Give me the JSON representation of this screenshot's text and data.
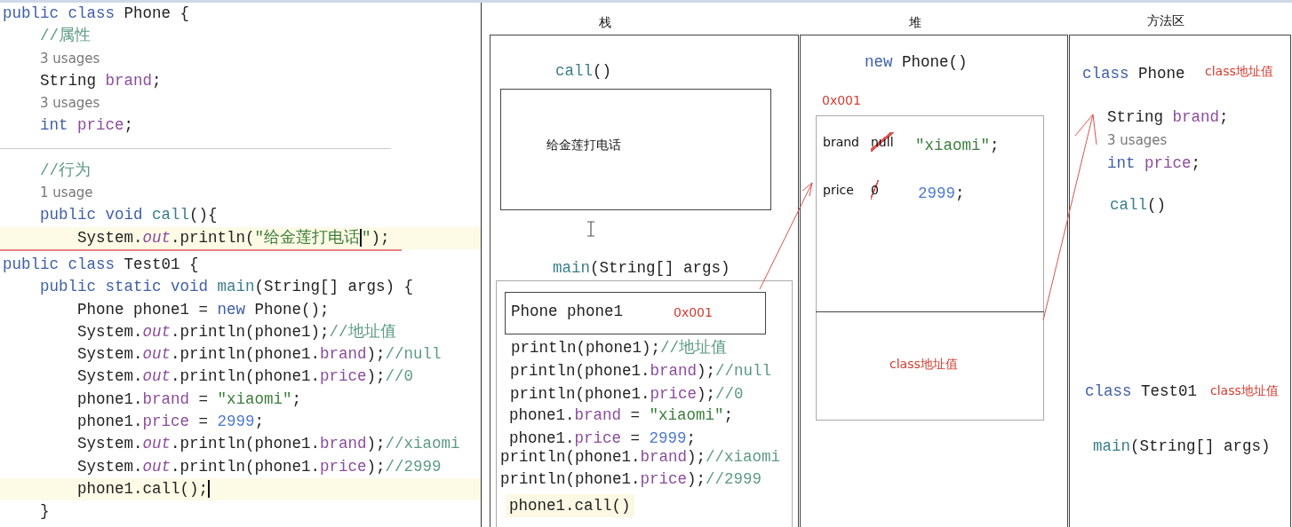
{
  "editor": {
    "lines": [
      {
        "kind": "code",
        "highlighted": false,
        "tokens": [
          {
            "text": "public class ",
            "kind": "kw"
          },
          {
            "text": "Phone {",
            "kind": "plain"
          }
        ]
      },
      {
        "kind": "code",
        "highlighted": false,
        "tokens": [
          {
            "text": "    //属性",
            "kind": "cmt"
          }
        ]
      },
      {
        "kind": "hint",
        "highlighted": false,
        "tokens": [
          {
            "text": "3 usages",
            "kind": "hint"
          }
        ]
      },
      {
        "kind": "code",
        "highlighted": false,
        "tokens": [
          {
            "text": "    String ",
            "kind": "plain"
          },
          {
            "text": "brand",
            "kind": "field"
          },
          {
            "text": ";",
            "kind": "plain"
          }
        ]
      },
      {
        "kind": "hint",
        "highlighted": false,
        "tokens": [
          {
            "text": "3 usages",
            "kind": "hint"
          }
        ]
      },
      {
        "kind": "code",
        "highlighted": false,
        "tokens": [
          {
            "text": "    int ",
            "kind": "kw"
          },
          {
            "text": "price",
            "kind": "field"
          },
          {
            "text": ";",
            "kind": "plain"
          }
        ]
      },
      {
        "kind": "divider"
      },
      {
        "kind": "code",
        "highlighted": false,
        "tokens": [
          {
            "text": "    //行为",
            "kind": "cmt"
          }
        ]
      },
      {
        "kind": "hint",
        "highlighted": false,
        "tokens": [
          {
            "text": "1 usage",
            "kind": "hint"
          }
        ]
      },
      {
        "kind": "code",
        "highlighted": false,
        "tokens": [
          {
            "text": "    public void ",
            "kind": "kw"
          },
          {
            "text": "call",
            "kind": "method"
          },
          {
            "text": "(){",
            "kind": "plain"
          }
        ]
      },
      {
        "kind": "code",
        "highlighted": true,
        "tokens": [
          {
            "text": "        System.",
            "kind": "plain"
          },
          {
            "text": "out",
            "kind": "static"
          },
          {
            "text": ".println(",
            "kind": "plain"
          },
          {
            "text": "\"给金莲打电话",
            "kind": "str",
            "caret": true
          },
          {
            "text": "\"",
            "kind": "str"
          },
          {
            "text": ");",
            "kind": "plain"
          }
        ]
      },
      {
        "kind": "rule"
      },
      {
        "kind": "code",
        "highlighted": false,
        "tokens": [
          {
            "text": "public class ",
            "kind": "kw"
          },
          {
            "text": "Test01 {",
            "kind": "plain"
          }
        ]
      },
      {
        "kind": "code",
        "highlighted": false,
        "tokens": [
          {
            "text": "    public static void ",
            "kind": "kw"
          },
          {
            "text": "main",
            "kind": "method"
          },
          {
            "text": "(String[] args) {",
            "kind": "plain"
          }
        ]
      },
      {
        "kind": "code",
        "highlighted": false,
        "tokens": [
          {
            "text": "        Phone phone1 = ",
            "kind": "plain"
          },
          {
            "text": "new",
            "kind": "kw"
          },
          {
            "text": " Phone();",
            "kind": "plain"
          }
        ]
      },
      {
        "kind": "code",
        "highlighted": false,
        "tokens": [
          {
            "text": "        System.",
            "kind": "plain"
          },
          {
            "text": "out",
            "kind": "static"
          },
          {
            "text": ".println(phone1);",
            "kind": "plain"
          },
          {
            "text": "//地址值",
            "kind": "cmt"
          }
        ]
      },
      {
        "kind": "code",
        "highlighted": false,
        "tokens": [
          {
            "text": "        System.",
            "kind": "plain"
          },
          {
            "text": "out",
            "kind": "static"
          },
          {
            "text": ".println(phone1.",
            "kind": "plain"
          },
          {
            "text": "brand",
            "kind": "field"
          },
          {
            "text": ");",
            "kind": "plain"
          },
          {
            "text": "//null",
            "kind": "cmt"
          }
        ]
      },
      {
        "kind": "code",
        "highlighted": false,
        "tokens": [
          {
            "text": "        System.",
            "kind": "plain"
          },
          {
            "text": "out",
            "kind": "static"
          },
          {
            "text": ".println(phone1.",
            "kind": "plain"
          },
          {
            "text": "price",
            "kind": "field"
          },
          {
            "text": ");",
            "kind": "plain"
          },
          {
            "text": "//0",
            "kind": "cmt"
          }
        ]
      },
      {
        "kind": "code",
        "highlighted": false,
        "tokens": [
          {
            "text": "        phone1.",
            "kind": "plain"
          },
          {
            "text": "brand",
            "kind": "field"
          },
          {
            "text": " = ",
            "kind": "plain"
          },
          {
            "text": "\"xiaomi\"",
            "kind": "str"
          },
          {
            "text": ";",
            "kind": "plain"
          }
        ]
      },
      {
        "kind": "code",
        "highlighted": false,
        "tokens": [
          {
            "text": "        phone1.",
            "kind": "plain"
          },
          {
            "text": "price",
            "kind": "field"
          },
          {
            "text": " = ",
            "kind": "plain"
          },
          {
            "text": "2999",
            "kind": "num"
          },
          {
            "text": ";",
            "kind": "plain"
          }
        ]
      },
      {
        "kind": "code",
        "highlighted": false,
        "tokens": [
          {
            "text": "        System.",
            "kind": "plain"
          },
          {
            "text": "out",
            "kind": "static"
          },
          {
            "text": ".println(phone1.",
            "kind": "plain"
          },
          {
            "text": "brand",
            "kind": "field"
          },
          {
            "text": ");",
            "kind": "plain"
          },
          {
            "text": "//xiaomi",
            "kind": "cmt"
          }
        ]
      },
      {
        "kind": "code",
        "highlighted": false,
        "tokens": [
          {
            "text": "        System.",
            "kind": "plain"
          },
          {
            "text": "out",
            "kind": "static"
          },
          {
            "text": ".println(phone1.",
            "kind": "plain"
          },
          {
            "text": "price",
            "kind": "field"
          },
          {
            "text": ");",
            "kind": "plain"
          },
          {
            "text": "//2999",
            "kind": "cmt"
          }
        ]
      },
      {
        "kind": "code",
        "highlighted": true,
        "tokens": [
          {
            "text": "        phone1.call();",
            "kind": "plain",
            "caret": true
          }
        ]
      },
      {
        "kind": "code",
        "highlighted": false,
        "tokens": [
          {
            "text": "    }",
            "kind": "plain"
          }
        ]
      }
    ]
  },
  "memory_diagram": {
    "stack": {
      "title": "栈",
      "call_frame": {
        "label": [
          {
            "text": "call",
            "kind": "method"
          },
          {
            "text": "()",
            "kind": "plain"
          }
        ],
        "output": "给金莲打电话"
      },
      "main_frame": {
        "label": [
          {
            "text": "main",
            "kind": "method"
          },
          {
            "text": "(String[] args)",
            "kind": "plain"
          }
        ],
        "variable": {
          "declaration": "Phone phone1",
          "value": "0x001"
        },
        "lines": [
          {
            "highlighted": false,
            "tokens": [
              {
                "text": "println(phone1);",
                "kind": "plain"
              },
              {
                "text": "//地址值",
                "kind": "cmt"
              }
            ]
          },
          {
            "highlighted": false,
            "tokens": [
              {
                "text": "println(phone1.",
                "kind": "plain"
              },
              {
                "text": "brand",
                "kind": "field"
              },
              {
                "text": ");",
                "kind": "plain"
              },
              {
                "text": "//null",
                "kind": "cmt"
              }
            ]
          },
          {
            "highlighted": false,
            "tokens": [
              {
                "text": "println(phone1.",
                "kind": "plain"
              },
              {
                "text": "price",
                "kind": "field"
              },
              {
                "text": ");",
                "kind": "plain"
              },
              {
                "text": "//0",
                "kind": "cmt"
              }
            ]
          },
          {
            "highlighted": false,
            "tokens": [
              {
                "text": "phone1.",
                "kind": "plain"
              },
              {
                "text": "brand",
                "kind": "field"
              },
              {
                "text": " = ",
                "kind": "plain"
              },
              {
                "text": "\"xiaomi\"",
                "kind": "str"
              },
              {
                "text": ";",
                "kind": "plain"
              }
            ]
          },
          {
            "highlighted": false,
            "tokens": [
              {
                "text": "phone1.",
                "kind": "plain"
              },
              {
                "text": "price",
                "kind": "field"
              },
              {
                "text": " = ",
                "kind": "plain"
              },
              {
                "text": "2999",
                "kind": "num"
              },
              {
                "text": ";",
                "kind": "plain"
              }
            ]
          },
          {
            "highlighted": false,
            "tokens": [
              {
                "text": "println(phone1.",
                "kind": "plain"
              },
              {
                "text": "brand",
                "kind": "field"
              },
              {
                "text": ");",
                "kind": "plain"
              },
              {
                "text": "//xiaomi",
                "kind": "cmt"
              }
            ]
          },
          {
            "highlighted": false,
            "tokens": [
              {
                "text": "println(phone1.",
                "kind": "plain"
              },
              {
                "text": "price",
                "kind": "field"
              },
              {
                "text": ");",
                "kind": "plain"
              },
              {
                "text": "//2999",
                "kind": "cmt"
              }
            ]
          },
          {
            "highlighted": true,
            "tokens": [
              {
                "text": "phone1.call()",
                "kind": "plain"
              }
            ]
          }
        ]
      }
    },
    "heap": {
      "title": "堆",
      "object": {
        "label": [
          {
            "text": "new",
            "kind": "kw"
          },
          {
            "text": " Phone()",
            "kind": "plain"
          }
        ],
        "address": "0x001",
        "fields": [
          {
            "name": "brand",
            "old_value": "null",
            "crossed_out": true,
            "new_value": [
              {
                "text": "\"xiaomi\"",
                "kind": "str"
              },
              {
                "text": ";",
                "kind": "plain"
              }
            ]
          },
          {
            "name": "price",
            "old_value": "0",
            "crossed_out": true,
            "new_value": [
              {
                "text": "2999",
                "kind": "num"
              },
              {
                "text": ";",
                "kind": "plain"
              }
            ]
          }
        ],
        "class_ref": "class地址值"
      }
    },
    "method_area": {
      "title": "方法区",
      "classes": [
        {
          "label": [
            {
              "text": "class ",
              "kind": "kw"
            },
            {
              "text": "Phone",
              "kind": "plain"
            }
          ],
          "address": "class地址值",
          "members": [
            {
              "tokens": [
                {
                  "text": "String ",
                  "kind": "plain"
                },
                {
                  "text": "brand",
                  "kind": "field"
                },
                {
                  "text": ";",
                  "kind": "plain"
                }
              ]
            },
            {
              "tokens": [
                {
                  "text": "3 usages",
                  "kind": "hint"
                }
              ]
            },
            {
              "tokens": [
                {
                  "text": "int ",
                  "kind": "kw"
                },
                {
                  "text": "price",
                  "kind": "field"
                },
                {
                  "text": ";",
                  "kind": "plain"
                }
              ]
            },
            {
              "tokens": [
                {
                  "text": "call",
                  "kind": "method"
                },
                {
                  "text": "()",
                  "kind": "plain"
                }
              ]
            }
          ]
        },
        {
          "label": [
            {
              "text": "class ",
              "kind": "kw"
            },
            {
              "text": "Test01",
              "kind": "plain"
            }
          ],
          "address": "class地址值",
          "members": [
            {
              "tokens": [
                {
                  "text": "main",
                  "kind": "method"
                },
                {
                  "text": "(String[] args)",
                  "kind": "plain"
                }
              ]
            }
          ]
        }
      ]
    }
  }
}
